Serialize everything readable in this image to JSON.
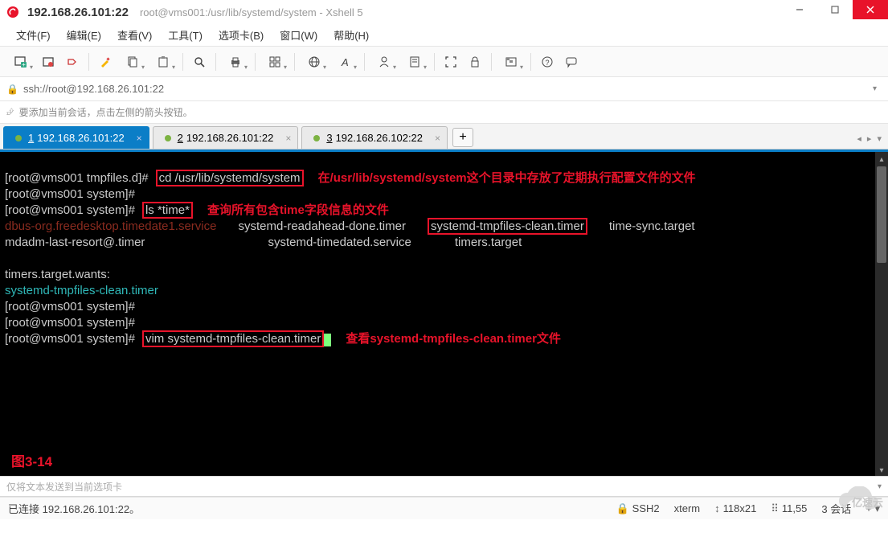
{
  "window": {
    "ip": "192.168.26.101:22",
    "subtitle": "root@vms001:/usr/lib/systemd/system - Xshell 5"
  },
  "menu": [
    "文件(F)",
    "编辑(E)",
    "查看(V)",
    "工具(T)",
    "选项卡(B)",
    "窗口(W)",
    "帮助(H)"
  ],
  "address": {
    "url": "ssh://root@192.168.26.101:22"
  },
  "hint": "要添加当前会话，点击左侧的箭头按钮。",
  "tabs": [
    {
      "num": "1",
      "label": "192.168.26.101:22",
      "active": true
    },
    {
      "num": "2",
      "label": "192.168.26.101:22",
      "active": false
    },
    {
      "num": "3",
      "label": "192.168.26.102:22",
      "active": false
    }
  ],
  "terminal": {
    "prompt1": "[root@vms001 tmpfiles.d]#",
    "cmd1": "cd /usr/lib/systemd/system",
    "ann1": "在/usr/lib/systemd/system这个目录中存放了定期执行配置文件的文件",
    "prompt2": "[root@vms001 system]#",
    "prompt3": "[root@vms001 system]#",
    "cmd2": "ls *time*",
    "ann2": "查询所有包含time字段信息的文件",
    "out_l1_a": "dbus-org.freedesktop.timedate1.service",
    "out_l1_b": "systemd-readahead-done.timer",
    "out_l1_c": "systemd-tmpfiles-clean.timer",
    "out_l1_d": "time-sync.target",
    "out_l2_a": "mdadm-last-resort@.timer",
    "out_l2_b": "systemd-timedated.service",
    "out_l2_c": "timers.target",
    "out_blank": "",
    "out_l3": "timers.target.wants:",
    "out_l4": "systemd-tmpfiles-clean.timer",
    "prompt4": "[root@vms001 system]#",
    "prompt5": "[root@vms001 system]#",
    "prompt6": "[root@vms001 system]#",
    "cmd3": "vim systemd-tmpfiles-clean.timer",
    "ann3": "查看systemd-tmpfiles-clean.timer文件",
    "figlabel": "图3-14"
  },
  "sendbar": "仅将文本发送到当前选项卡",
  "status": {
    "left": "已连接 192.168.26.101:22。",
    "ssh": "SSH2",
    "term": "xterm",
    "size": "118x21",
    "pos": "11,55",
    "sess": "3 会话"
  },
  "watermark": "亿速云"
}
